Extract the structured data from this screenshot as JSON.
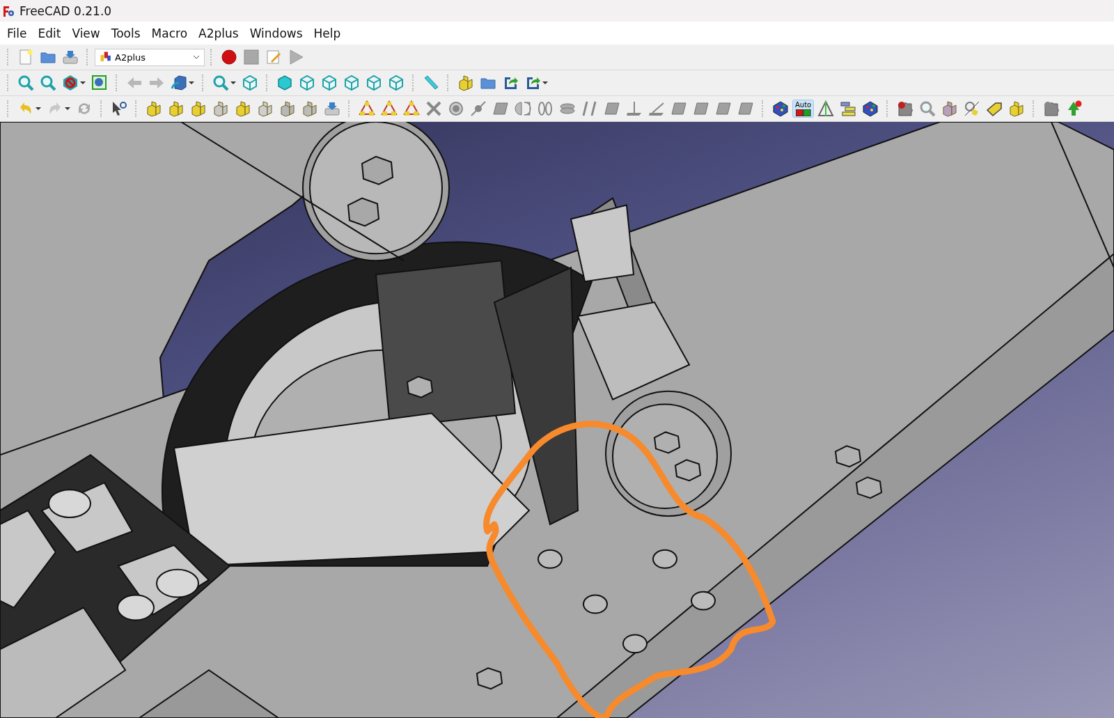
{
  "window": {
    "title": "FreeCAD 0.21.0"
  },
  "menu_bar": [
    "File",
    "Edit",
    "View",
    "Tools",
    "Macro",
    "A2plus",
    "Windows",
    "Help"
  ],
  "workbench_selector": {
    "value": "A2plus"
  },
  "toolbar_toggle": {
    "label": "Auto",
    "selected": true
  }
}
